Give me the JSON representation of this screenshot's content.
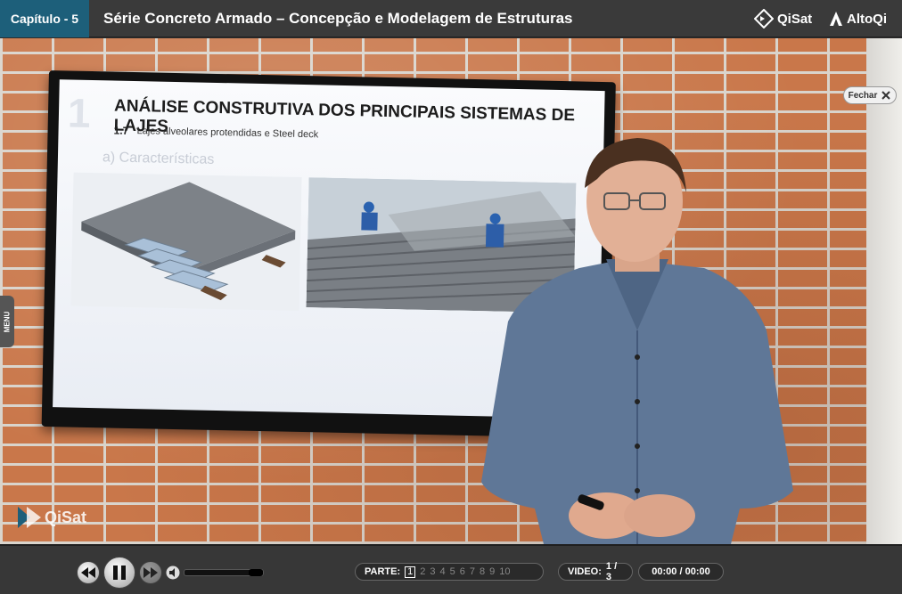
{
  "header": {
    "chapter": "Capítulo - 5",
    "title": "Série Concreto Armado – Concepção e Modelagem de Estruturas",
    "brand_qisat": "QiSat",
    "brand_altoqi": "AltoQi"
  },
  "video": {
    "close_label": "Fechar",
    "menu_label": "MENU",
    "watermark": "QiSat"
  },
  "slide": {
    "number": "1",
    "title": "ANÁLISE CONSTRUTIVA DOS PRINCIPAIS SISTEMAS DE LAJES",
    "subtitle_number": "1.7",
    "subtitle": "Lajes alveolares protendidas e Steel deck",
    "section": "a) Características"
  },
  "controls": {
    "parts_label": "PARTE:",
    "parts": [
      "1",
      "2",
      "3",
      "4",
      "5",
      "6",
      "7",
      "8",
      "9",
      "10"
    ],
    "active_part": "1",
    "video_label": "VIDEO:",
    "video_value": "1 / 3",
    "time": "00:00 / 00:00",
    "volume_level": 0.82
  }
}
